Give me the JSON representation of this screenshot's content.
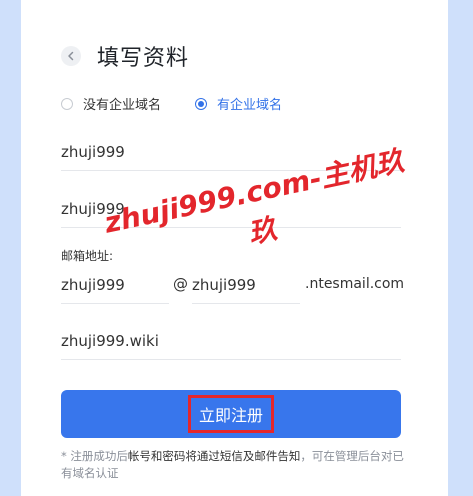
{
  "page": {
    "title": "填写资料"
  },
  "domain_options": [
    {
      "label": "没有企业域名",
      "checked": false
    },
    {
      "label": "有企业域名",
      "checked": true
    }
  ],
  "fields": {
    "field1": "zhuji999",
    "field2": "zhuji999",
    "email_label": "邮箱地址:",
    "email_user": "zhuji999",
    "email_at": "@",
    "email_domain": "zhuji999",
    "email_suffix": ".ntesmail.com",
    "domain": "zhuji999.wiki"
  },
  "register": {
    "label": "立即注册"
  },
  "note": {
    "prefix": "* 注册成功后",
    "highlight": "帐号和密码将通过短信及邮件告知",
    "suffix": "，可在管理后台对已有域名认证"
  },
  "watermark": {
    "text": "zhuji999.com-主机玖玖"
  },
  "colors": {
    "accent": "#3876ec",
    "background": "#cfe0fb",
    "highlight_box": "#e5262b",
    "watermark": "#e3262c"
  }
}
